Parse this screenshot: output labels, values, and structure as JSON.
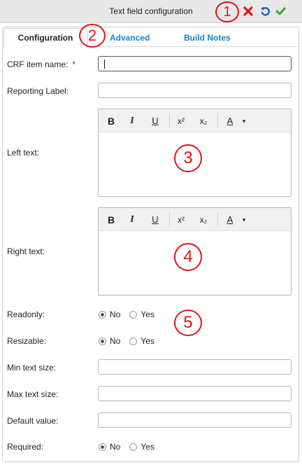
{
  "header": {
    "title": "Text field configuration",
    "cancel_icon": "close-icon",
    "undo_icon": "undo-icon",
    "confirm_icon": "checkmark-icon",
    "colors": {
      "cancel": "#e0141a",
      "undo": "#1a5fc4",
      "confirm": "#3ea33a"
    }
  },
  "tabs": [
    {
      "label": "Configuration",
      "active": true
    },
    {
      "label": "Advanced",
      "active": false
    },
    {
      "label": "Build Notes",
      "active": false
    }
  ],
  "form": {
    "crf_item_name": {
      "label": "CRF item name:",
      "required_mark": "*",
      "value": ""
    },
    "reporting_label": {
      "label": "Reporting Label:",
      "value": ""
    },
    "left_text": {
      "label": "Left text:",
      "value": ""
    },
    "right_text": {
      "label": "Right text:",
      "value": ""
    },
    "readonly": {
      "label": "Readonly:",
      "options": [
        "No",
        "Yes"
      ],
      "selected": "No"
    },
    "resizable": {
      "label": "Resizable:",
      "options": [
        "No",
        "Yes"
      ],
      "selected": "No"
    },
    "min_text_size": {
      "label": "Min text size:",
      "value": ""
    },
    "max_text_size": {
      "label": "Max text size:",
      "value": ""
    },
    "default_value": {
      "label": "Default value:",
      "value": ""
    },
    "required": {
      "label": "Required:",
      "options": [
        "No",
        "Yes"
      ],
      "selected": "No"
    }
  },
  "editor_toolbar": {
    "bold": "B",
    "italic": "I",
    "underline": "U",
    "superscript": "x²",
    "subscript": "x₂",
    "font_color": "A",
    "dropdown": "▾"
  },
  "annotations": [
    "1",
    "2",
    "3",
    "4",
    "5"
  ],
  "accent_color": "#1a84c9"
}
